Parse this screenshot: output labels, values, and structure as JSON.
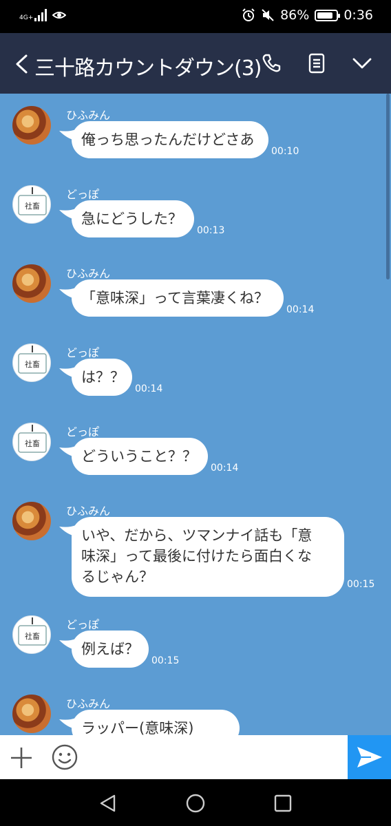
{
  "status_bar": {
    "network": "4G+",
    "battery_percent": "86%",
    "battery_level": 0.86,
    "time": "0:36",
    "icons": [
      "signal-icon",
      "eye-icon",
      "alarm-icon",
      "mute-icon",
      "battery-icon"
    ]
  },
  "header": {
    "title": "三十路カウントダウン(3)",
    "icons": [
      "back-arrow-icon",
      "phone-icon",
      "notes-icon",
      "chevron-down-icon"
    ]
  },
  "messages": [
    {
      "sender": "ひふみん",
      "avatar": "food-photo",
      "lines": [
        "俺っち思ったんだけどさあ"
      ],
      "time": "00:10"
    },
    {
      "sender": "どっぽ",
      "avatar": "badge-photo",
      "lines": [
        "急にどうした？"
      ],
      "time": "00:13"
    },
    {
      "sender": "ひふみん",
      "avatar": "food-photo",
      "lines": [
        "「意味深」って言葉凄くね？"
      ],
      "time": "00:14"
    },
    {
      "sender": "どっぽ",
      "avatar": "badge-photo",
      "lines": [
        "は？？"
      ],
      "time": "00:14"
    },
    {
      "sender": "どっぽ",
      "avatar": "badge-photo",
      "lines": [
        "どういうこと？？"
      ],
      "time": "00:14"
    },
    {
      "sender": "ひふみん",
      "avatar": "food-photo",
      "lines": [
        "いや、だから、ツマンナイ話も「意",
        "味深」って最後に付けたら面白くな",
        "るじゃん？"
      ],
      "time": "00:15"
    },
    {
      "sender": "どっぽ",
      "avatar": "badge-photo",
      "lines": [
        "例えば？"
      ],
      "time": "00:15"
    },
    {
      "sender": "ひふみん",
      "avatar": "food-photo",
      "lines": [
        "ラッパー(意味深)"
      ],
      "time": ""
    }
  ],
  "badge_text": "社畜",
  "input": {
    "icons": [
      "plus-icon",
      "smile-icon",
      "send-icon"
    ]
  },
  "colors": {
    "header_bg": "#273048",
    "chat_bg": "#5c9cd3",
    "send_bg": "#2196f3"
  }
}
